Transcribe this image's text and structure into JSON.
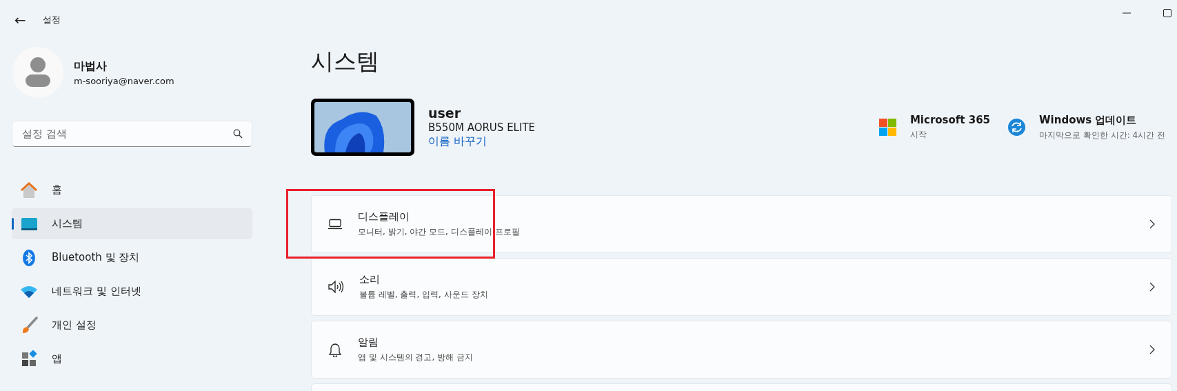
{
  "window": {
    "title": "설정",
    "back": "←"
  },
  "account": {
    "name": "마법사",
    "email": "m-sooriya@naver.com"
  },
  "search": {
    "placeholder": "설정 검색"
  },
  "sidebar": {
    "items": [
      {
        "label": "홈",
        "kind": "home",
        "selected": false
      },
      {
        "label": "시스템",
        "kind": "system",
        "selected": true
      },
      {
        "label": "Bluetooth 및 장치",
        "kind": "bluetooth",
        "selected": false
      },
      {
        "label": "네트워크 및 인터넷",
        "kind": "network",
        "selected": false
      },
      {
        "label": "개인 설정",
        "kind": "brush",
        "selected": false
      },
      {
        "label": "앱",
        "kind": "apps",
        "selected": false
      }
    ]
  },
  "page": {
    "title": "시스템"
  },
  "device": {
    "name": "user",
    "model": "B550M AORUS ELITE",
    "rename": "이름 바꾸기"
  },
  "quick_links": [
    {
      "kind": "office",
      "title": "Microsoft 365",
      "subtitle": "시작"
    },
    {
      "kind": "update",
      "title": "Windows 업데이트",
      "subtitle": "마지막으로 확인한 시간: 4시간 전"
    }
  ],
  "settings": [
    {
      "kind": "display",
      "title": "디스플레이",
      "subtitle": "모니터, 밝기, 야간 모드, 디스플레이 프로필",
      "highlighted": true
    },
    {
      "kind": "sound",
      "title": "소리",
      "subtitle": "볼륨 레벨, 출력, 입력, 사운드 장치",
      "highlighted": false
    },
    {
      "kind": "bell",
      "title": "알림",
      "subtitle": "앱 및 시스템의 경고, 방해 금지",
      "highlighted": false
    }
  ]
}
